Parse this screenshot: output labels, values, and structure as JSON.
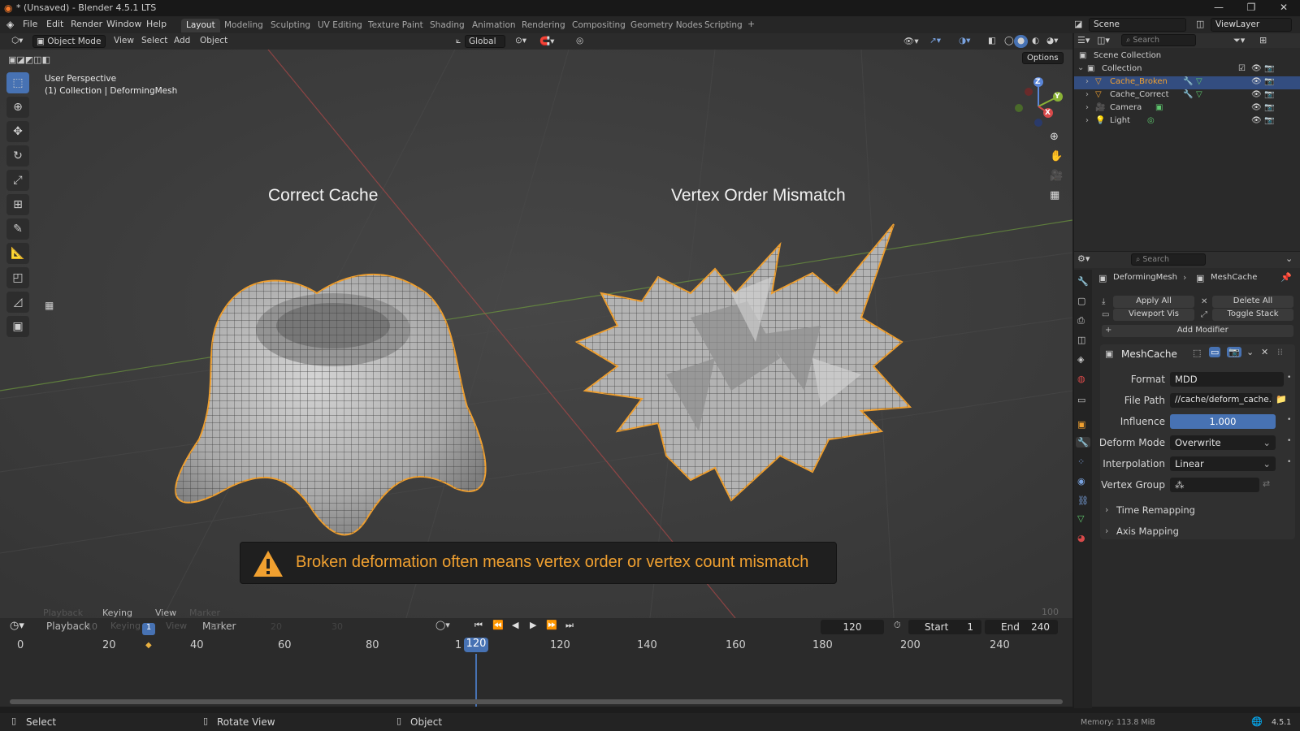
{
  "window": {
    "title": "* (Unsaved) - Blender 4.5.1 LTS"
  },
  "menubar": {
    "menus": [
      "File",
      "Edit",
      "Render",
      "Window",
      "Help"
    ],
    "workspaces": [
      "Layout",
      "Modeling",
      "Sculpting",
      "UV Editing",
      "Texture Paint",
      "Shading",
      "Animation",
      "Rendering",
      "Compositing",
      "Geometry Nodes",
      "Scripting"
    ],
    "active_workspace": "Layout",
    "add_tab": "+",
    "scene": "Scene",
    "view_layer": "ViewLayer"
  },
  "viewport_header": {
    "mode": "Object Mode",
    "menus": [
      "View",
      "Select",
      "Add",
      "Object"
    ],
    "orientation": "Global",
    "options": "Options"
  },
  "viewport": {
    "perspective": "User Perspective",
    "collection_info": "(1) Collection | DeformingMesh",
    "left_label": "Correct Cache",
    "right_label": "Vertex Order Mismatch",
    "warning_text": "Broken deformation often means vertex order or vertex count mismatch",
    "gizmo_axes": [
      "X",
      "Y",
      "Z"
    ]
  },
  "outliner": {
    "search_placeholder": "Search",
    "root": "Scene Collection",
    "collection": "Collection",
    "items": [
      {
        "name": "Cache_Broken",
        "selected": true
      },
      {
        "name": "Cache_Correct",
        "selected": false
      },
      {
        "name": "Camera",
        "selected": false
      },
      {
        "name": "Light",
        "selected": false
      }
    ]
  },
  "properties": {
    "search_placeholder": "Search",
    "breadcrumb_object": "DeformingMesh",
    "breadcrumb_modifier": "MeshCache",
    "apply_all": "Apply All",
    "delete_all": "Delete All",
    "viewport_vis": "Viewport Vis",
    "toggle_stack": "Toggle Stack",
    "add_modifier": "Add Modifier",
    "modifier_name": "MeshCache",
    "fields": {
      "format_label": "Format",
      "format_value": "MDD",
      "filepath_label": "File Path",
      "filepath_value": "//cache/deform_cache.mdd",
      "influence_label": "Influence",
      "influence_value": "1.000",
      "deform_mode_label": "Deform Mode",
      "deform_mode_value": "Overwrite",
      "interpolation_label": "Interpolation",
      "interpolation_value": "Linear",
      "vertex_group_label": "Vertex Group"
    },
    "time_remapping": "Time Remapping",
    "axis_mapping": "Axis Mapping"
  },
  "timeline": {
    "menus": [
      "Playback",
      "Keying",
      "View",
      "Marker"
    ],
    "current_frame": "120",
    "start_label": "Start",
    "start_value": "1",
    "end_label": "End",
    "end_value": "240",
    "ticks": [
      "0",
      "20",
      "40",
      "60",
      "80",
      "120",
      "140",
      "160",
      "180",
      "200",
      "240"
    ],
    "playhead_label": "120",
    "ghost_ticks": [
      "-10",
      "10",
      "20",
      "30"
    ],
    "ghost_labels": [
      "Playback",
      "Keying",
      "View",
      "Marker"
    ],
    "marker_label": "1",
    "playhead_prefix": "1",
    "right_value": "100"
  },
  "statusbar": {
    "select": "Select",
    "rotate_view": "Rotate View",
    "object": "Object",
    "memory": "Memory: 113.8 MiB",
    "version": "4.5.1"
  },
  "colors": {
    "accent": "#4772b3",
    "selection_outline": "#f0a030",
    "warning": "#f0a030"
  }
}
